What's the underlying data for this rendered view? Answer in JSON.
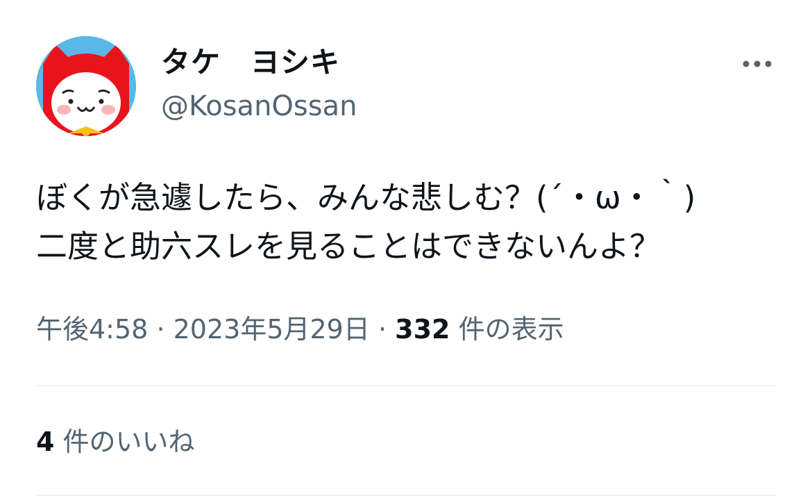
{
  "tweet": {
    "author": {
      "display_name": "タケ　ヨシキ",
      "handle": "@KosanOssan",
      "avatar_icon": "cat-mascot-avatar"
    },
    "text": "ぼくが急遽したら、みんな悲しむ？(´・ω・｀)\n二度と助六スレを見ることはできないんよ？",
    "timestamp": {
      "time": "午後4:58",
      "separator": "·",
      "date": "2023年5月29日"
    },
    "views": {
      "count": "332",
      "label": "件の表示"
    },
    "likes": {
      "count": "4",
      "label": "件のいいね"
    },
    "colors": {
      "secondary_text": "#536471",
      "divider": "#eff3f4",
      "avatar_bg": "#5ab8e8",
      "avatar_hood": "#e8141c"
    }
  }
}
